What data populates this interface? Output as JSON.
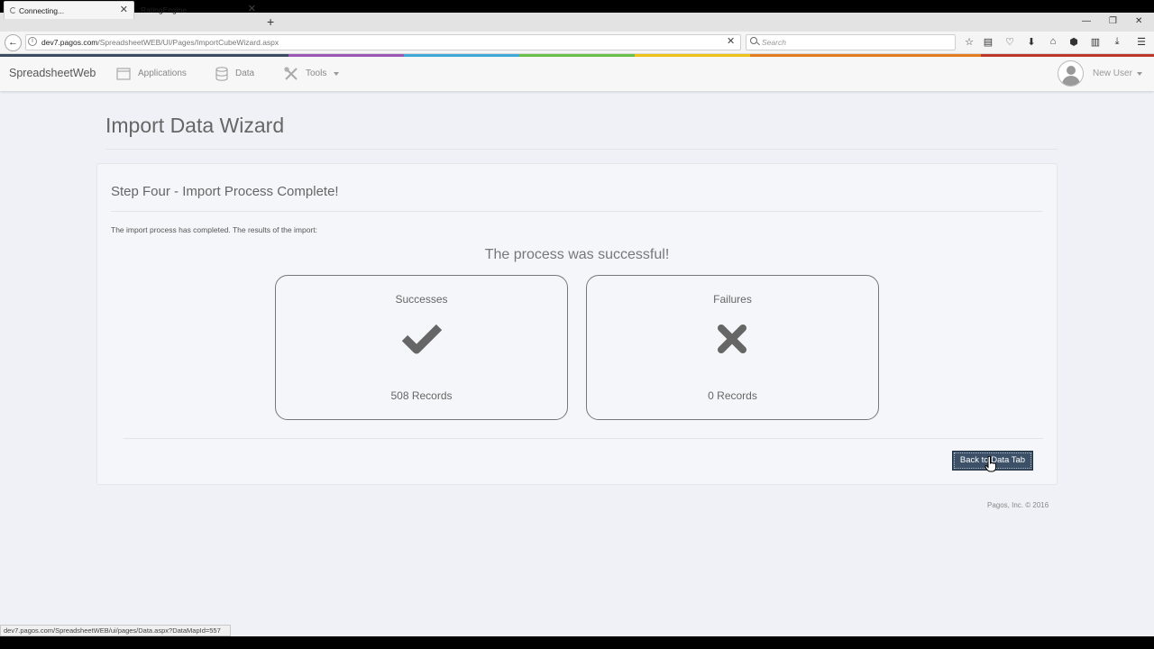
{
  "browser": {
    "tabs": [
      {
        "label": "Connecting...",
        "active": true
      },
      {
        "label": "RatingEngine",
        "active": false
      }
    ],
    "url_host": "dev7.pagos.com",
    "url_path": "/SpreadsheetWEB/UI/Pages/ImportCubeWizard.aspx",
    "search_placeholder": "Search",
    "status_url": "dev7.pagos.com/SpreadsheetWEB/ui/pages/Data.aspx?DataMapId=557",
    "stripe_colors": [
      "#3d4d61",
      "#9b59b6",
      "#3fa9d9",
      "#6cc24a",
      "#f0c419",
      "#e67e22",
      "#c0392b"
    ]
  },
  "app": {
    "brand": "SpreadsheetWeb",
    "nav": [
      {
        "label": "Applications",
        "icon": "window-icon"
      },
      {
        "label": "Data",
        "icon": "database-icon"
      },
      {
        "label": "Tools",
        "icon": "tools-icon"
      }
    ],
    "user": "New User"
  },
  "page": {
    "title": "Import Data Wizard",
    "step_title": "Step Four - Import Process Complete!",
    "description": "The import process has completed. The results of the import:",
    "success_message": "The process was successful!",
    "cards": [
      {
        "title": "Successes",
        "icon": "checkmark-icon",
        "count": "508 Records"
      },
      {
        "title": "Failures",
        "icon": "x-mark-icon",
        "count": "0 Records"
      }
    ],
    "back_button": "Back to Data Tab",
    "copyright": "Pagos, Inc. © 2016"
  }
}
